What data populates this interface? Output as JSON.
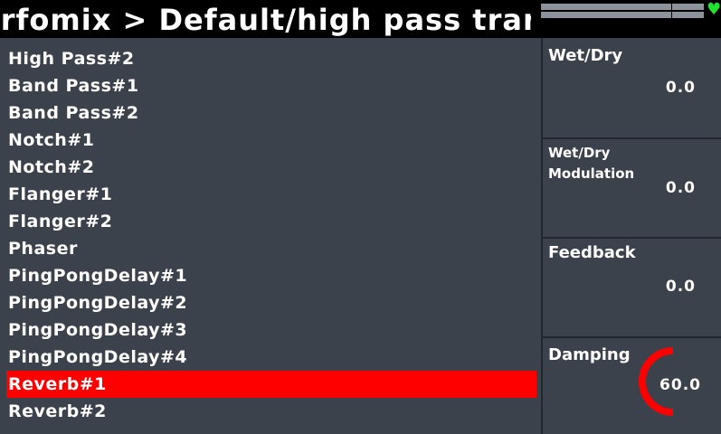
{
  "header": {
    "title": "erfomix > Default/high pass trans",
    "status_icon": "heart-icon",
    "status_color": "#1ee32f"
  },
  "effects": {
    "items": [
      "High Pass#2",
      "Band Pass#1",
      "Band Pass#2",
      "Notch#1",
      "Notch#2",
      "Flanger#1",
      "Flanger#2",
      "Phaser",
      "PingPongDelay#1",
      "PingPongDelay#2",
      "PingPongDelay#3",
      "PingPongDelay#4",
      "Reverb#1",
      "Reverb#2"
    ],
    "selected": "Reverb#1",
    "selected_color": "#ff0000"
  },
  "params": {
    "wet_dry": {
      "label": "Wet/Dry",
      "value": "0.0"
    },
    "wet_dry_modulation": {
      "label_line1": "Wet/Dry",
      "label_line2": "Modulation",
      "value": "0.0"
    },
    "feedback": {
      "label": "Feedback",
      "value": "0.0"
    },
    "damping": {
      "label": "Damping",
      "value": "60.0",
      "level_fraction": 0.6,
      "arc_color": "#ff0000"
    }
  }
}
